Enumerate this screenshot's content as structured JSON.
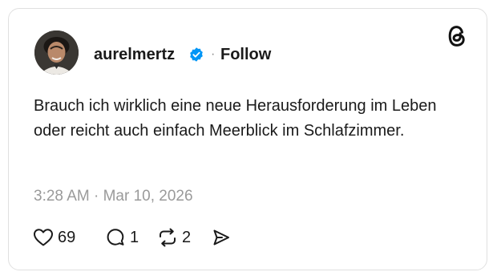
{
  "post": {
    "username": "aurelmertz",
    "separator": "·",
    "follow_label": "Follow",
    "text": "Brauch ich wirklich eine neue Herausforderung im Leben oder reicht auch einfach Meerblick im Schlafzimmer.",
    "timestamp": "3:28 AM · Mar 10, 2026"
  },
  "actions": {
    "likes": "69",
    "replies": "1",
    "reposts": "2"
  },
  "icons": {
    "verified": "verified-badge-icon",
    "logo": "threads-logo-icon",
    "like": "heart-icon",
    "reply": "comment-icon",
    "repost": "repost-icon",
    "share": "send-icon"
  },
  "colors": {
    "verified": "#0095f6",
    "text": "#1a1a1a",
    "muted": "#9a9a9a",
    "border": "#e0e0e0"
  }
}
